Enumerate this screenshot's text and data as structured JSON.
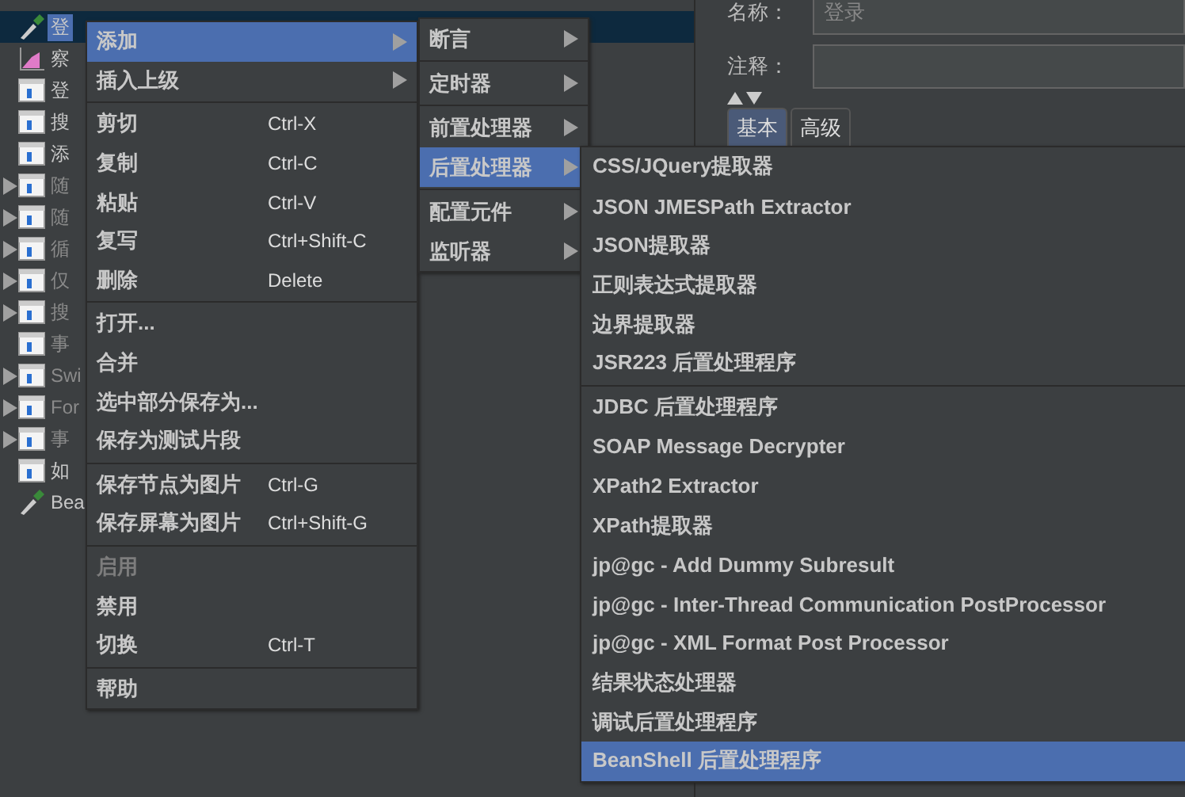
{
  "tree": {
    "items": [
      {
        "label": "登",
        "kind": "pipette",
        "arrow": false,
        "disabled": false,
        "selected": true
      },
      {
        "label": "察",
        "kind": "chart",
        "arrow": false,
        "disabled": false,
        "selected": false
      },
      {
        "label": "登",
        "kind": "window",
        "arrow": false,
        "disabled": false,
        "selected": false
      },
      {
        "label": "搜",
        "kind": "window",
        "arrow": false,
        "disabled": false,
        "selected": false
      },
      {
        "label": "添",
        "kind": "window",
        "arrow": false,
        "disabled": false,
        "selected": false
      },
      {
        "label": "随",
        "kind": "window",
        "arrow": true,
        "disabled": true,
        "selected": false
      },
      {
        "label": "随",
        "kind": "window",
        "arrow": true,
        "disabled": true,
        "selected": false
      },
      {
        "label": "循",
        "kind": "window",
        "arrow": true,
        "disabled": true,
        "selected": false
      },
      {
        "label": "仅",
        "kind": "window",
        "arrow": true,
        "disabled": true,
        "selected": false
      },
      {
        "label": "搜",
        "kind": "window",
        "arrow": true,
        "disabled": true,
        "selected": false
      },
      {
        "label": "事",
        "kind": "window",
        "arrow": false,
        "disabled": true,
        "selected": false
      },
      {
        "label": "Swi",
        "kind": "window",
        "arrow": true,
        "disabled": true,
        "selected": false
      },
      {
        "label": "For",
        "kind": "window",
        "arrow": true,
        "disabled": true,
        "selected": false
      },
      {
        "label": "事",
        "kind": "window",
        "arrow": true,
        "disabled": true,
        "selected": false
      },
      {
        "label": "如",
        "kind": "window",
        "arrow": false,
        "disabled": false,
        "selected": false
      },
      {
        "label": "Bea",
        "kind": "pipette",
        "arrow": false,
        "disabled": false,
        "selected": false
      }
    ]
  },
  "form": {
    "name_label": "名称：",
    "name_value": "登录",
    "comment_label": "注释：",
    "tabs": [
      {
        "label": "基本",
        "selected": true
      },
      {
        "label": "高级",
        "selected": false
      }
    ]
  },
  "context_menu": {
    "groups": [
      [
        {
          "label": "添加",
          "submenu": true,
          "disabled": false,
          "selected": true
        },
        {
          "label": "插入上级",
          "submenu": true,
          "disabled": false,
          "selected": false
        }
      ],
      [
        {
          "label": "剪切",
          "shortcut": "Ctrl-X",
          "submenu": false,
          "disabled": false,
          "selected": false
        },
        {
          "label": "复制",
          "shortcut": "Ctrl-C",
          "submenu": false,
          "disabled": false,
          "selected": false
        },
        {
          "label": "粘贴",
          "shortcut": "Ctrl-V",
          "submenu": false,
          "disabled": false,
          "selected": false
        },
        {
          "label": "复写",
          "shortcut": "Ctrl+Shift-C",
          "submenu": false,
          "disabled": false,
          "selected": false
        },
        {
          "label": "删除",
          "shortcut": "Delete",
          "submenu": false,
          "disabled": false,
          "selected": false
        }
      ],
      [
        {
          "label": "打开...",
          "submenu": false,
          "disabled": false,
          "selected": false
        },
        {
          "label": "合并",
          "submenu": false,
          "disabled": false,
          "selected": false
        },
        {
          "label": "选中部分保存为...",
          "submenu": false,
          "disabled": false,
          "selected": false
        },
        {
          "label": "保存为测试片段",
          "submenu": false,
          "disabled": false,
          "selected": false
        }
      ],
      [
        {
          "label": "保存节点为图片",
          "shortcut": "Ctrl-G",
          "submenu": false,
          "disabled": false,
          "selected": false
        },
        {
          "label": "保存屏幕为图片",
          "shortcut": "Ctrl+Shift-G",
          "submenu": false,
          "disabled": false,
          "selected": false
        }
      ],
      [
        {
          "label": "启用",
          "submenu": false,
          "disabled": true,
          "selected": false
        },
        {
          "label": "禁用",
          "submenu": false,
          "disabled": false,
          "selected": false
        },
        {
          "label": "切换",
          "shortcut": "Ctrl-T",
          "submenu": false,
          "disabled": false,
          "selected": false
        }
      ],
      [
        {
          "label": "帮助",
          "submenu": false,
          "disabled": false,
          "selected": false
        }
      ]
    ]
  },
  "add_submenu": {
    "groups": [
      [
        {
          "label": "断言",
          "selected": false
        }
      ],
      [
        {
          "label": "定时器",
          "selected": false
        }
      ],
      [
        {
          "label": "前置处理器",
          "selected": false
        },
        {
          "label": "后置处理器",
          "selected": true
        }
      ],
      [
        {
          "label": "配置元件",
          "selected": false
        },
        {
          "label": "监听器",
          "selected": false
        }
      ]
    ]
  },
  "postprocessor_submenu": {
    "groups": [
      [
        {
          "label": "CSS/JQuery提取器",
          "selected": false
        },
        {
          "label": "JSON JMESPath Extractor",
          "selected": false
        },
        {
          "label": "JSON提取器",
          "selected": false
        },
        {
          "label": "正则表达式提取器",
          "selected": false
        },
        {
          "label": "边界提取器",
          "selected": false
        },
        {
          "label": "JSR223 后置处理程序",
          "selected": false
        }
      ],
      [
        {
          "label": "JDBC 后置处理程序",
          "selected": false
        },
        {
          "label": "SOAP Message Decrypter",
          "selected": false
        },
        {
          "label": "XPath2 Extractor",
          "selected": false
        },
        {
          "label": "XPath提取器",
          "selected": false
        },
        {
          "label": "jp@gc - Add Dummy Subresult",
          "selected": false
        },
        {
          "label": "jp@gc - Inter-Thread Communication PostProcessor",
          "selected": false
        },
        {
          "label": "jp@gc - XML Format Post Processor",
          "selected": false
        },
        {
          "label": "结果状态处理器",
          "selected": false
        },
        {
          "label": "调试后置处理程序",
          "selected": false
        },
        {
          "label": "BeanShell 后置处理程序",
          "selected": true
        }
      ]
    ]
  }
}
